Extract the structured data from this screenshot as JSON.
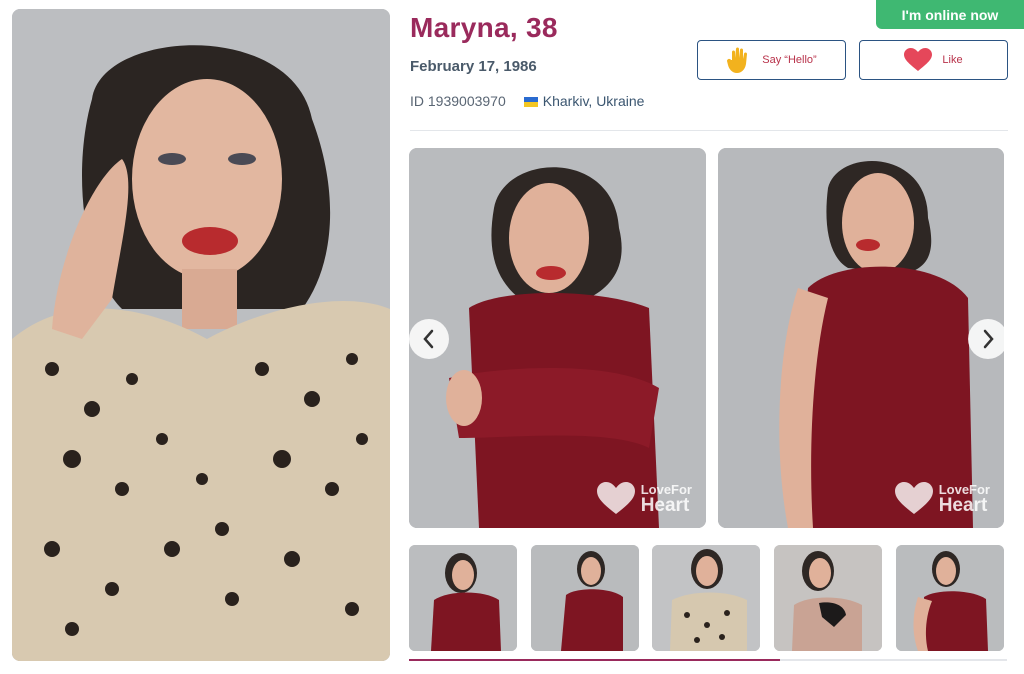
{
  "profile": {
    "name": "Maryna, 38",
    "dob": "February 17, 1986",
    "id_text": "ID 1939003970",
    "location": "Kharkiv, Ukraine",
    "online_status": "I'm online now"
  },
  "actions": {
    "hello_label": "Say “Hello”",
    "like_label": "Like"
  },
  "gallery": {
    "watermark_top": "LoveFor",
    "watermark_bottom": "Heart",
    "thumbnail_count": 5,
    "progress": 0.62
  },
  "colors": {
    "accent": "#9a2a5c",
    "online": "#3fb872",
    "button_border": "#2b5382",
    "like_heart": "#e5475a",
    "hello_hand": "#f2b21e"
  },
  "icons": {
    "hello": "waving-hand-icon",
    "like": "heart-icon",
    "prev": "chevron-left-icon",
    "next": "chevron-right-icon",
    "flag": "ukraine-flag-icon"
  }
}
